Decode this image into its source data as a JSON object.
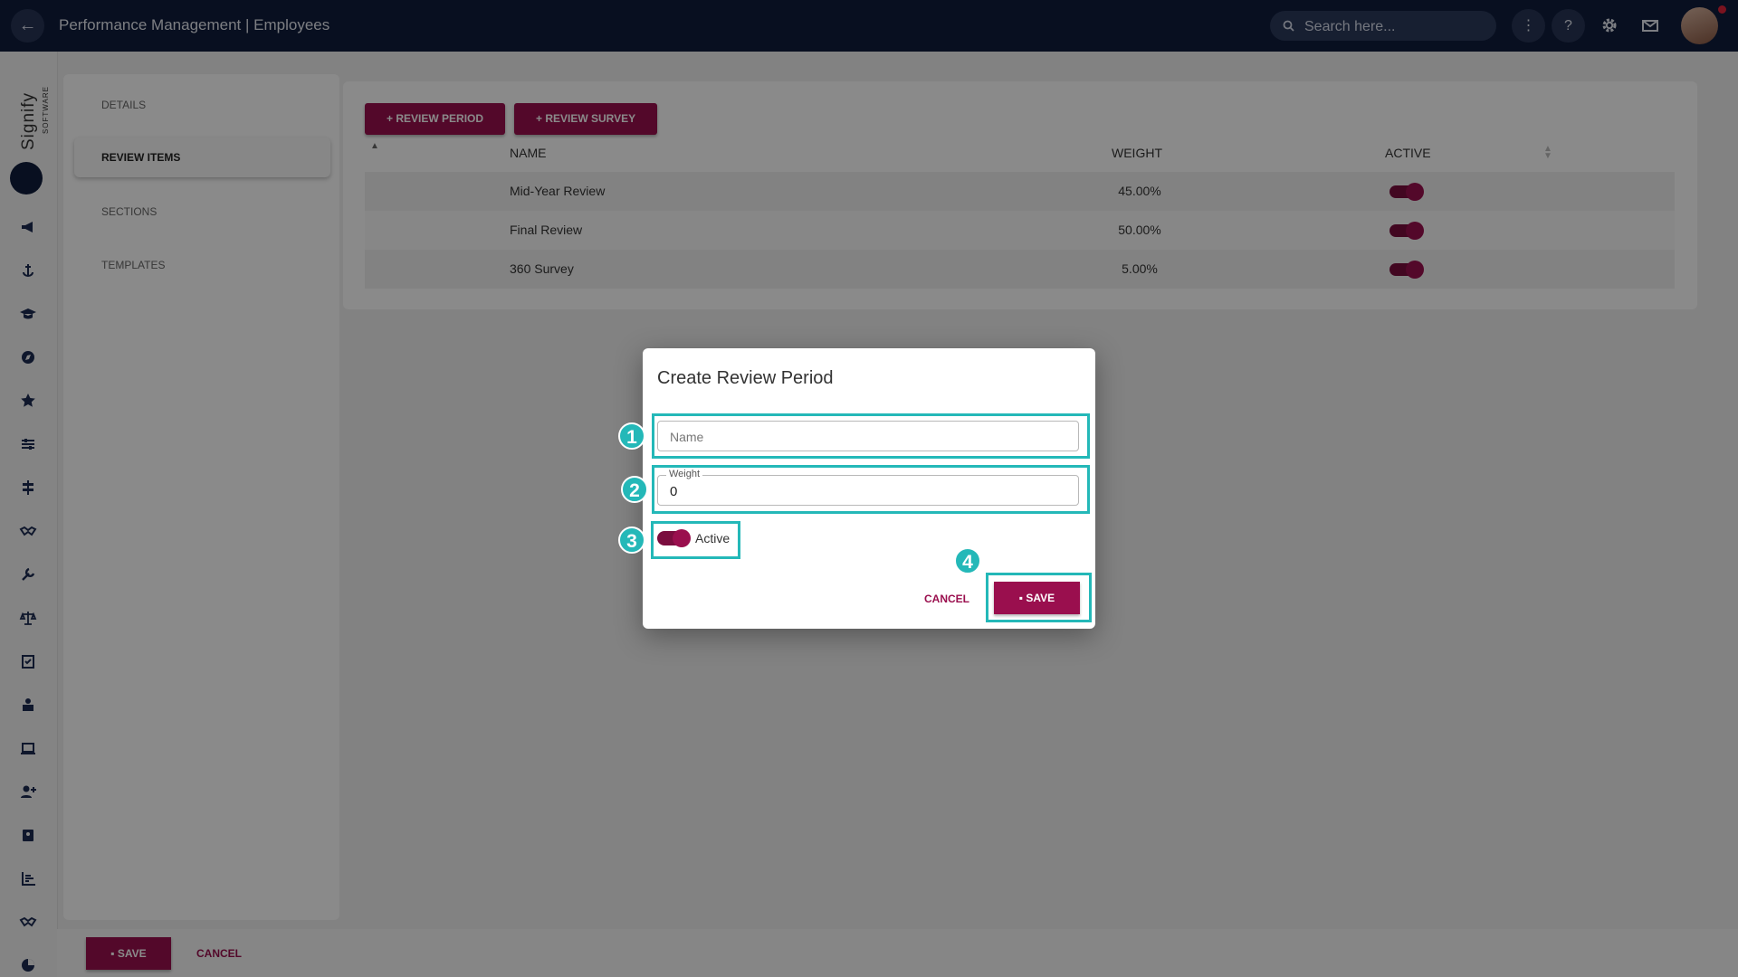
{
  "topbar": {
    "title": "Performance Management | Employees",
    "search_placeholder": "Search here...",
    "more_label": "⋮",
    "help_label": "?"
  },
  "brand": {
    "name": "Signify",
    "sub": "SOFTWARE"
  },
  "subnav": {
    "items": [
      "DETAILS",
      "REVIEW ITEMS",
      "SECTIONS",
      "TEMPLATES"
    ],
    "active": "REVIEW ITEMS"
  },
  "actions": {
    "review_period": "REVIEW PERIOD",
    "review_survey": "REVIEW SURVEY"
  },
  "table": {
    "headers": {
      "name": "NAME",
      "weight": "WEIGHT",
      "active": "ACTIVE"
    },
    "rows": [
      {
        "name": "Mid-Year Review",
        "weight": "45.00%",
        "active": true
      },
      {
        "name": "Final Review",
        "weight": "50.00%",
        "active": true
      },
      {
        "name": "360 Survey",
        "weight": "5.00%",
        "active": true
      }
    ]
  },
  "bottombar": {
    "save": "SAVE",
    "cancel": "CANCEL"
  },
  "modal": {
    "title": "Create Review Period",
    "name_placeholder": "Name",
    "name_value": "",
    "weight_label": "Weight",
    "weight_value": "0",
    "active_label": "Active",
    "active": true,
    "cancel": "CANCEL",
    "save": "SAVE"
  },
  "annotations": [
    "1",
    "2",
    "3",
    "4"
  ],
  "colors": {
    "primary": "#9a0f4e",
    "header": "#0f1c3c",
    "highlight": "#24b8b8"
  }
}
